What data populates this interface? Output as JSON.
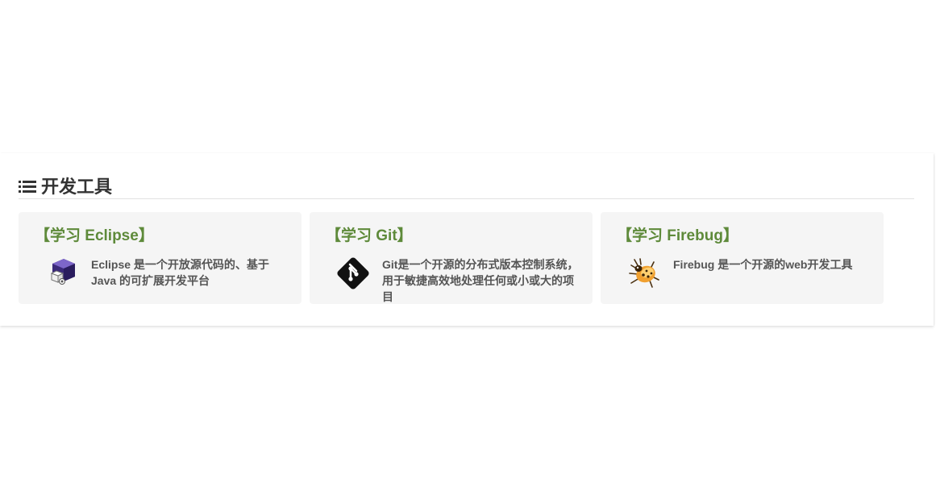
{
  "section": {
    "title": "开发工具"
  },
  "cards": [
    {
      "title": "【学习 Eclipse】",
      "description": "Eclipse 是一个开放源代码的、基于 Java 的可扩展开发平台",
      "icon": "eclipse-logo-icon"
    },
    {
      "title": "【学习 Git】",
      "description": "Git是一个开源的分布式版本控制系统，用于敏捷高效地处理任何或小或大的项目",
      "icon": "git-logo-icon"
    },
    {
      "title": "【学习 Firebug】",
      "description": "Firebug 是一个开源的web开发工具",
      "icon": "firebug-logo-icon"
    }
  ],
  "colors": {
    "card_title": "#5e8a3a",
    "card_background": "#f5f5f5",
    "section_title": "#333333",
    "description_text": "#555555"
  }
}
